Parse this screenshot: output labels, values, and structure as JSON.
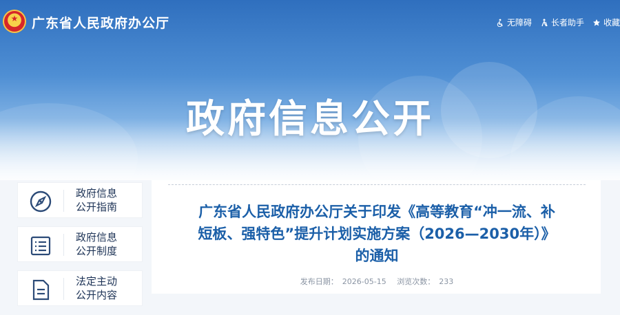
{
  "header": {
    "site_title": "广东省人民政府办公厅",
    "tools": [
      {
        "label": "无障碍",
        "icon": "accessibility-icon"
      },
      {
        "label": "长者助手",
        "icon": "elder-assistant-icon"
      },
      {
        "label": "收藏",
        "icon": "bookmark-icon"
      }
    ]
  },
  "banner": {
    "title": "政府信息公开"
  },
  "sidebar": {
    "items": [
      {
        "label_line1": "政府信息",
        "label_line2": "公开指南",
        "icon": "compass-icon"
      },
      {
        "label_line1": "政府信息",
        "label_line2": "公开制度",
        "icon": "list-document-icon"
      },
      {
        "label_line1": "法定主动",
        "label_line2": "公开内容",
        "icon": "file-icon"
      }
    ]
  },
  "article": {
    "title_line1": "广东省人民政府办公厅关于印发《高等教育“冲一流、补",
    "title_line2": "短板、强特色”提升计划实施方案（2026—2030年）》",
    "title_line3": "的通知",
    "publish_label": "发布日期：",
    "publish_date": "2026-05-15",
    "views_label": "浏览次数：",
    "views": "233"
  },
  "colors": {
    "accent": "#1b5fa8",
    "banner": "#2f6fbe",
    "text_dark": "#1d3356"
  }
}
